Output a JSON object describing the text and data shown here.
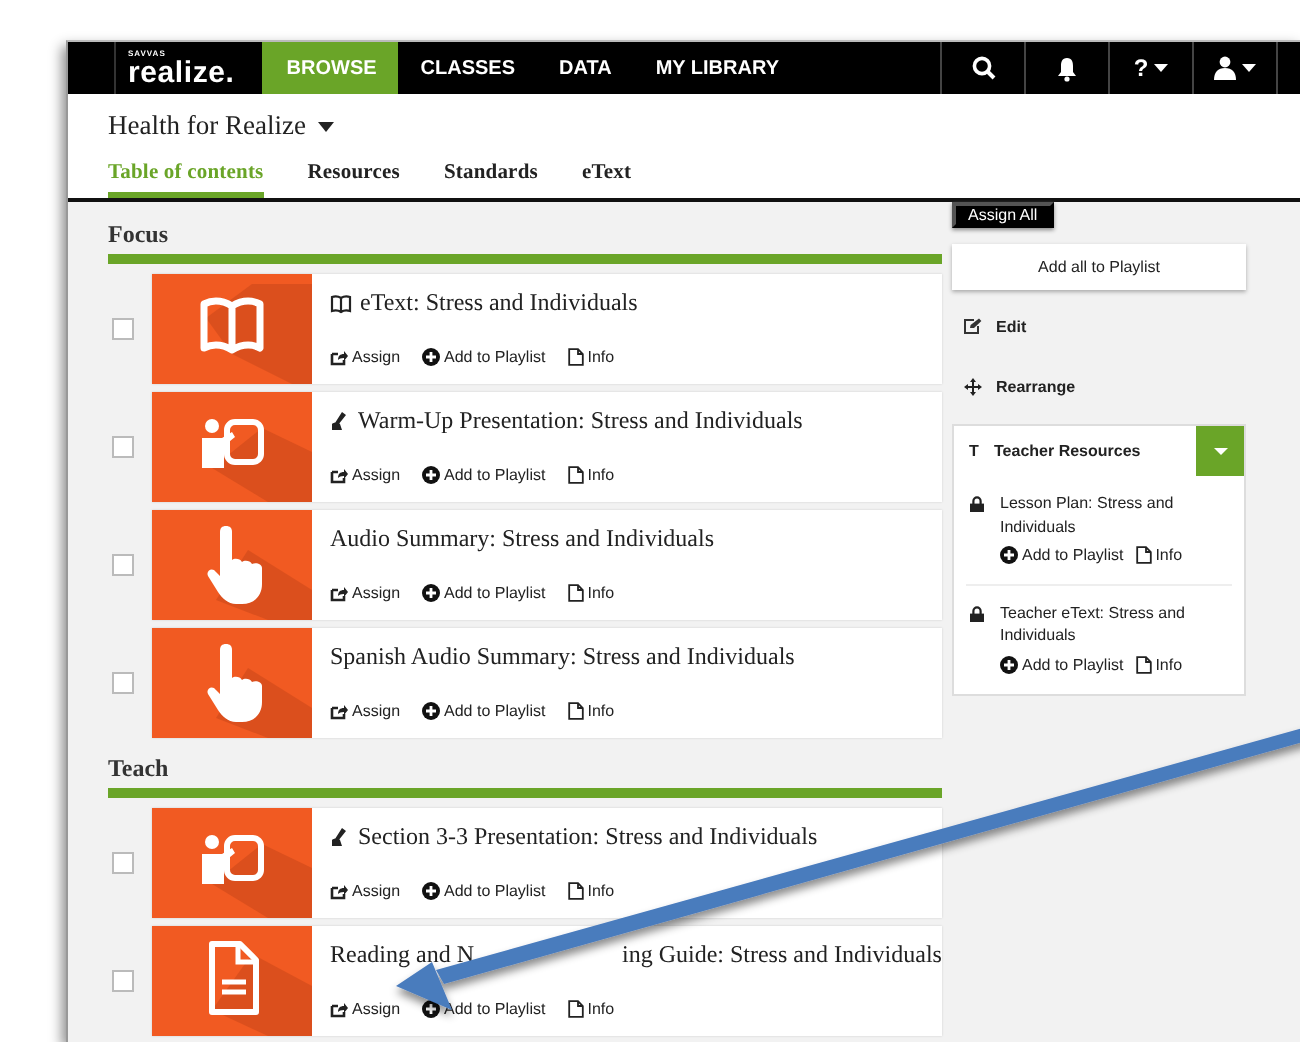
{
  "nav": {
    "logo_small": "SAVVAS",
    "logo": "realize.",
    "tabs": [
      {
        "label": "BROWSE",
        "selected": true
      },
      {
        "label": "CLASSES",
        "selected": false
      },
      {
        "label": "DATA",
        "selected": false
      },
      {
        "label": "MY LIBRARY",
        "selected": false
      }
    ],
    "help": "?"
  },
  "course": {
    "title": "Health for Realize",
    "tabs": [
      {
        "label": "Table of contents",
        "selected": true
      },
      {
        "label": "Resources",
        "selected": false
      },
      {
        "label": "Standards",
        "selected": false
      },
      {
        "label": "eText",
        "selected": false
      }
    ]
  },
  "sections": [
    {
      "title": "Focus",
      "items": [
        {
          "kind": "book",
          "checked": false,
          "title": "eText: Stress and Individuals",
          "actions": [
            {
              "kind": "assign",
              "label": "Assign"
            },
            {
              "kind": "playlist",
              "label": "Add to Playlist"
            },
            {
              "kind": "info",
              "label": "Info"
            }
          ]
        },
        {
          "kind": "presenter",
          "checked": false,
          "title": "Warm-Up Presentation: Stress and Individuals",
          "actions": [
            {
              "kind": "assign",
              "label": "Assign"
            },
            {
              "kind": "playlist",
              "label": "Add to Playlist"
            },
            {
              "kind": "info",
              "label": "Info"
            }
          ]
        },
        {
          "kind": "hand",
          "checked": false,
          "title": "Audio Summary: Stress and Individuals",
          "actions": [
            {
              "kind": "assign",
              "label": "Assign"
            },
            {
              "kind": "playlist",
              "label": "Add to Playlist"
            },
            {
              "kind": "info",
              "label": "Info"
            }
          ]
        },
        {
          "kind": "hand",
          "checked": false,
          "title": "Spanish Audio Summary: Stress and Individuals",
          "actions": [
            {
              "kind": "assign",
              "label": "Assign"
            },
            {
              "kind": "playlist",
              "label": "Add to Playlist"
            },
            {
              "kind": "info",
              "label": "Info"
            }
          ]
        }
      ]
    },
    {
      "title": "Teach",
      "items": [
        {
          "kind": "presenter",
          "checked": false,
          "title": "Section 3-3 Presentation: Stress and Individuals",
          "actions": [
            {
              "kind": "assign",
              "label": "Assign"
            },
            {
              "kind": "playlist",
              "label": "Add to Playlist"
            },
            {
              "kind": "info",
              "label": "Info"
            }
          ]
        },
        {
          "kind": "document",
          "checked": false,
          "title": "Reading and N",
          "title_after_arrow": "ing Guide: Stress and Individuals",
          "actions": [
            {
              "kind": "assign",
              "label": "Assign"
            },
            {
              "kind": "playlist",
              "label": "Add to Playlist"
            },
            {
              "kind": "info",
              "label": "Info"
            }
          ]
        }
      ]
    }
  ],
  "side": {
    "assign_all": "Assign All",
    "add_all": "Add all to Playlist",
    "links": [
      {
        "kind": "edit",
        "label": "Edit"
      },
      {
        "kind": "rearrange",
        "label": "Rearrange"
      }
    ],
    "teacher_resources": {
      "letter": "T",
      "title": "Teacher Resources",
      "expanded": true,
      "items": [
        {
          "title": "Lesson Plan: Stress and Individuals",
          "locked": true,
          "actions": [
            {
              "kind": "playlist",
              "label": "Add to Playlist"
            },
            {
              "kind": "info",
              "label": "Info"
            }
          ]
        },
        {
          "title": "Teacher eText: Stress and Individuals",
          "locked": true,
          "actions": [
            {
              "kind": "playlist",
              "label": "Add to Playlist"
            },
            {
              "kind": "info",
              "label": "Info"
            }
          ]
        }
      ]
    }
  }
}
